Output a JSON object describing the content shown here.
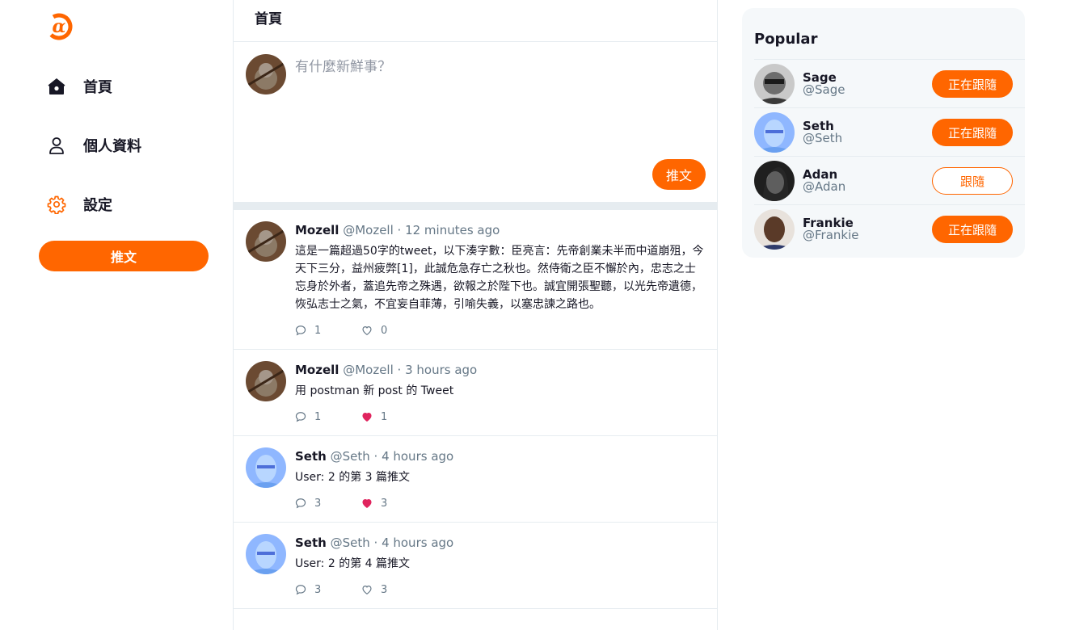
{
  "colors": {
    "accent": "#ff6600",
    "like_active": "#e0245e",
    "muted": "#657786"
  },
  "sidebar": {
    "logo_icon": "alpha-logo-icon",
    "items": [
      {
        "label": "首頁",
        "icon": "home-icon"
      },
      {
        "label": "個人資料",
        "icon": "user-icon"
      },
      {
        "label": "設定",
        "icon": "gear-icon"
      }
    ],
    "tweet_button": "推文"
  },
  "main": {
    "title": "首頁",
    "composer": {
      "placeholder": "有什麼新鮮事？",
      "submit": "推文"
    },
    "tweets": [
      {
        "name": "Mozell",
        "handle": "@Mozell",
        "time": "12 minutes ago",
        "text": "這是一篇超過50字的tweet，以下湊字數：臣亮言：先帝創業未半而中道崩殂，今天下三分，益州疲弊[1]，此誠危急存亡之秋也。然侍衛之臣不懈於內，忠志之士忘身於外者，蓋追先帝之殊遇，欲報之於陛下也。誠宜開張聖聽，以光先帝遺德，恢弘志士之氣，不宜妄自菲薄，引喻失義，以塞忠諫之路也。",
        "replies": "1",
        "likes": "0",
        "liked": false
      },
      {
        "name": "Mozell",
        "handle": "@Mozell",
        "time": "3 hours ago",
        "text": "用 postman 新 post 的 Tweet",
        "replies": "1",
        "likes": "1",
        "liked": true
      },
      {
        "name": "Seth",
        "handle": "@Seth",
        "time": "4 hours ago",
        "text": "User: 2 的第 3 篇推文",
        "replies": "3",
        "likes": "3",
        "liked": true
      },
      {
        "name": "Seth",
        "handle": "@Seth",
        "time": "4 hours ago",
        "text": "User: 2 的第 4 篇推文",
        "replies": "3",
        "likes": "3",
        "liked": false
      }
    ]
  },
  "popular": {
    "title": "Popular",
    "users": [
      {
        "name": "Sage",
        "handle": "@Sage",
        "button": "正在跟隨",
        "following": true
      },
      {
        "name": "Seth",
        "handle": "@Seth",
        "button": "正在跟隨",
        "following": true
      },
      {
        "name": "Adan",
        "handle": "@Adan",
        "button": "跟隨",
        "following": false
      },
      {
        "name": "Frankie",
        "handle": "@Frankie",
        "button": "正在跟隨",
        "following": true
      }
    ]
  }
}
